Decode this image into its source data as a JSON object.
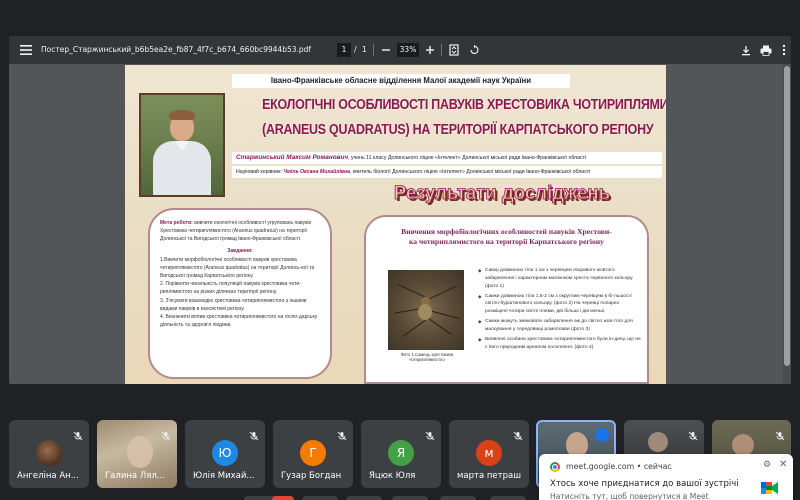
{
  "pdf_viewer": {
    "file_title": "Постер_Старжинський_b6b5ea2e_fb87_4f7c_b674_660bc9944b53.pdf",
    "current_page": "1",
    "page_separator": "/",
    "total_pages": "1",
    "zoom": "33%",
    "icons": [
      "menu-icon",
      "zoom-out-icon",
      "zoom-in-icon",
      "fit-page-icon",
      "rotate-icon",
      "download-icon",
      "print-icon",
      "more-vert-icon"
    ]
  },
  "poster": {
    "header": "Івано-Франківське обласне відділення Малої академії наук України",
    "title_line1": "ЕКОЛОГІЧНІ ОСОБЛИВОСТІ ПАВУКІВ ХРЕСТОВИКА ЧОТИРИПЛЯМИСТОГО",
    "title_line2": "(ARANEUS QUADRATUS) НА ТЕРИТОРІЇ КАРПАТСЬКОГО РЕГІОНУ",
    "author_name": "Старжинський Максим Романович",
    "author_rest": ", учень 11 класу Долинського ліцею «Інтелект» Долинської міської ради Івано-Франківської області",
    "supervisor_prefix": "Науковий керівник: ",
    "supervisor_name": "Чміль Оксана Михайлівна",
    "supervisor_rest": ", вчитель біології Долинського ліцею «Інтелект» Долинської міської ради Івано-Франківської області",
    "results_title": "Результати досліджень",
    "goals": {
      "label": "Мета роботи:",
      "text": " вивчити екологічні особливості угруповань павуків Хрестовика чотириплямистого (Araneus quadratus) на території Долинської та Вигодської громад Івано-Франківської області.",
      "tasks_label": "Завдання:",
      "tasks": [
        "1.Вивчити морфобіологічні особливості павуків хрестовика чотириплямистого (Araneus quadratus) на території Долинсь-кої та Вигодської громад Карпатського регіону.",
        "2. Порівняти чисельність популяцій павуків хрестовика чоти-риплямистого на різних ділянках території регіону.",
        "3. З'ясувати взаємодію хрестовика чотириплямистого з іншими видами павуків в екосистемі регіону.",
        "4. Визначити вплив хрестовика чотириплямистого на госпо-дарську діяльність та здоров'я людини."
      ]
    },
    "study": {
      "title_line1": "Вивчення морфобіологічних особливостей павуків Хрестови-",
      "title_line2": "ка чотириплямистого на території Карпатського регіону",
      "photo_caption": "Фото 1.Самець хрестовика чотириплямистого",
      "facts": [
        "Самці довжиною тіла 1 см з черевцем яскравого жовтого забарвлення і характерним малюнком хреста червоного кольору. (фото 1)",
        "Самки довжиною тіла 1,5-2 см з округлим черевцем в бі-льшості світло-бурштинового кольору. (фото 2) На черевці попарно розміщені чотири світлі плями, дві більші і дві менші.",
        "Самки можуть змінювати забарвлення аж до світло жов-того для маскування у середовищі ромоплави (фото 3)",
        "Виявлені особини хрестовика чотириплямистого були ін-дину, що не є його природним ареалом поселення. (фото 4)"
      ]
    }
  },
  "participants": [
    {
      "name": "Ангеліна Ан...",
      "initial": "",
      "muted": true
    },
    {
      "name": "Галина Лял...",
      "initial": "",
      "muted": true
    },
    {
      "name": "Юлія Михай...",
      "initial": "Ю",
      "muted": true
    },
    {
      "name": "Гузар Богдан",
      "initial": "Г",
      "muted": true
    },
    {
      "name": "Яцюк Юля",
      "initial": "Я",
      "muted": true
    },
    {
      "name": "марта петраш",
      "initial": "м",
      "muted": true
    },
    {
      "name": "",
      "initial": "",
      "muted": false,
      "speaking": true
    },
    {
      "name": "",
      "initial": "",
      "muted": true
    },
    {
      "name": "",
      "initial": "",
      "muted": true
    }
  ],
  "notification": {
    "source": "meet.google.com • сейчас",
    "title": "Хтось хоче приєднатися до вашої зустрічі",
    "body": "Натисніть тут, щоб повернутися в Meet",
    "icons": [
      "chrome-icon",
      "gear-icon",
      "close-icon",
      "google-meet-icon"
    ]
  },
  "colors": {
    "poster_title": "#8a1a54",
    "viewer_bg": "#525659",
    "toolbar_bg": "#323639",
    "tile_bg": "#3c4043",
    "speaking_border": "#8ab4f8"
  }
}
